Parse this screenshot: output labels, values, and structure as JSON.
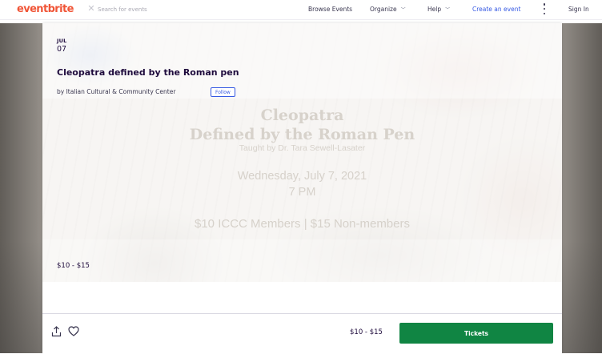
{
  "topnav": {
    "logo": "eventbrite",
    "search_placeholder": "Search for events",
    "items": [
      {
        "label": "Browse Events",
        "dropdown": false
      },
      {
        "label": "Organize",
        "dropdown": true
      },
      {
        "label": "Help",
        "dropdown": true
      },
      {
        "label": "Create an event",
        "dropdown": false
      }
    ],
    "signin": "Sign In"
  },
  "event": {
    "month": "JUL",
    "day": "07",
    "title": "Cleopatra defined by the Roman pen",
    "organizer": "by Italian Cultural & Community Center",
    "follow_label": "Follow",
    "price": "$10 - $15"
  },
  "flyer": {
    "title_line1": "Cleopatra",
    "title_line2": "Defined by the Roman Pen",
    "teacher": "Taught by Dr. Tara Sewell-Lasater",
    "date": "Wednesday, July 7, 2021",
    "time": "7 PM",
    "price": "$10 ICCC Members  | $15 Non-members"
  },
  "action_bar": {
    "price": "$10 - $15",
    "tickets_label": "Tickets"
  },
  "colors": {
    "brand": "#f05537",
    "link": "#3659e3",
    "tickets": "#108543",
    "text": "#1e0a3c"
  },
  "icons": [
    "close-icon",
    "more-vertical-icon",
    "chevron-down-icon",
    "share-icon",
    "heart-icon"
  ]
}
